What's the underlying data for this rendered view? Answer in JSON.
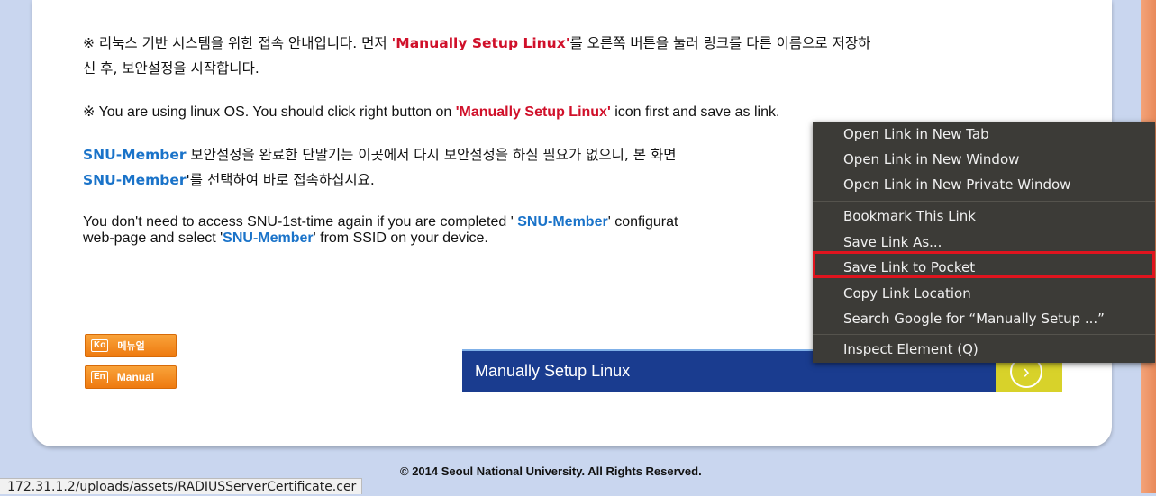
{
  "notices": {
    "kr1_a": "※ 리눅스 기반 시스템을 위한 접속 안내입니다. 먼저 ",
    "kr1_red": "'Manually Setup Linux'",
    "kr1_b": "를 오른쪽 버튼을 눌러 링크를 다른 이름으로 저장하",
    "kr1_c": "신 후, 보안설정을 시작합니다.",
    "en1_a": "※ You are using linux OS. You should click right button on ",
    "en1_red": "'Manually Setup Linux'",
    "en1_b": " icon first and save as link.",
    "kr2_blue": "SNU-Member",
    "kr2_a": " 보안설정을 완료한 단말기는 이곳에서 다시 보안설정을 하실 필요가 없으니, 본 화면",
    "kr2_blue2": "SNU-Member",
    "kr2_b": "'를 선택하여 바로 접속하십시요.",
    "en2_a": "You don't need to access SNU-1st-time again if you are completed ' ",
    "en2_blue": "SNU-Member",
    "en2_b": "' configurat",
    "en2_c": "web-page and select '",
    "en2_blue2": "SNU-Member",
    "en2_d": "' from SSID on your device."
  },
  "buttons": {
    "manual_kr_tag": "Ko",
    "manual_kr": "메뉴얼",
    "manual_en_tag": "En",
    "manual_en": "Manual",
    "setup_linux": "Manually Setup Linux",
    "setup_arrow": "›"
  },
  "footer": "© 2014 Seoul National University. All Rights Reserved.",
  "status_url": "172.31.1.2/uploads/assets/RADIUSServerCertificate.cer",
  "context_menu": [
    "Open Link in New Tab",
    "Open Link in New Window",
    "Open Link in New Private Window",
    "Bookmark This Link",
    "Save Link As...",
    "Save Link to Pocket",
    "Copy Link Location",
    "Search Google for “Manually Setup ...”",
    "Inspect Element (Q)"
  ],
  "colors": {
    "highlight": "#e0141e",
    "menu_bg": "#3c3b37",
    "link_blue": "#1a73c9",
    "emphasis_red": "#d0102a"
  }
}
